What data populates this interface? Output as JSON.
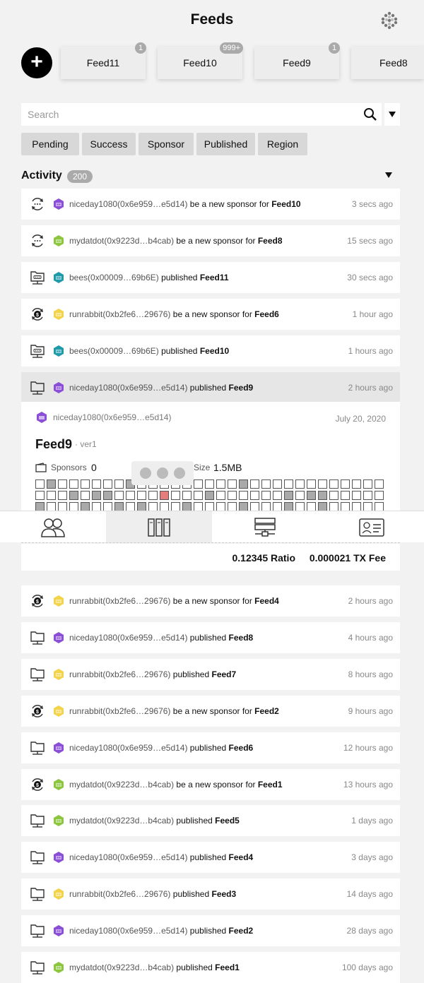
{
  "header": {
    "title": "Feeds",
    "logo_icon": "hexagon-cluster-icon"
  },
  "add_button": {
    "label": "+"
  },
  "feed_tabs": [
    {
      "label": "Feed11",
      "badge": "1"
    },
    {
      "label": "Feed10",
      "badge": "999+"
    },
    {
      "label": "Feed9",
      "badge": "1"
    },
    {
      "label": "Feed8",
      "badge": ""
    }
  ],
  "search": {
    "placeholder": "Search"
  },
  "filters": [
    "Pending",
    "Success",
    "Sponsor",
    "Published",
    "Region"
  ],
  "activity": {
    "title": "Activity",
    "count": "200"
  },
  "rows_top": [
    {
      "icon": "sponsor-loading-icon",
      "avatar": "#8a4fd6",
      "user": "niceday1080(0x6e959…e5d14)",
      "action": " be a new sponsor for ",
      "feed": "Feed10",
      "time": "3 secs ago"
    },
    {
      "icon": "sponsor-loading-icon",
      "avatar": "#8cc63f",
      "user": "mydatdot(0x9223d…b4cab)",
      "action": " be a new sponsor for ",
      "feed": "Feed8",
      "time": "15 secs ago"
    },
    {
      "icon": "published-pending-icon",
      "avatar": "#1f9aa8",
      "user": "bees(0x00009…69b6E)",
      "action": " published ",
      "feed": "Feed11",
      "time": "30 secs ago"
    },
    {
      "icon": "sponsor-dollar-icon",
      "avatar": "#f2d34a",
      "user": "runrabbit(0xb2fe6…29676)",
      "action": " be a new sponsor for ",
      "feed": "Feed6",
      "time": "1 hour ago"
    },
    {
      "icon": "published-pending-icon",
      "avatar": "#1f9aa8",
      "user": "bees(0x00009…69b6E)",
      "action": " published ",
      "feed": "Feed10",
      "time": "1 hours ago"
    },
    {
      "icon": "published-icon",
      "avatar": "#8a4fd6",
      "user": "niceday1080(0x6e959…e5d14)",
      "action": " published ",
      "feed": "Feed9",
      "time": "2 hours ago"
    }
  ],
  "detail": {
    "user": "niceday1080(0x6e959…e5d14)",
    "date": "July 20, 2020",
    "feed_name": "Feed9",
    "version": "· ver1",
    "sponsors_label": "Sponsors",
    "sponsors_value": "0",
    "size_label": "Size",
    "size_value": "1.5MB"
  },
  "nav": [
    {
      "name": "nav-users",
      "icon": "users-icon"
    },
    {
      "name": "nav-library",
      "icon": "library-icon"
    },
    {
      "name": "nav-servers",
      "icon": "server-icon"
    },
    {
      "name": "nav-profile",
      "icon": "id-card-icon"
    }
  ],
  "stats": {
    "ratio": "0.12345 Ratio",
    "fee": "0.000021 TX Fee"
  },
  "rows_bottom": [
    {
      "icon": "sponsor-dollar-icon",
      "avatar": "#f2d34a",
      "user": "runrabbit(0xb2fe6…29676)",
      "action": " be a new sponsor for ",
      "feed": "Feed4",
      "time": "2 hours ago"
    },
    {
      "icon": "published-icon",
      "avatar": "#8a4fd6",
      "user": "niceday1080(0x6e959…e5d14)",
      "action": " published ",
      "feed": "Feed8",
      "time": "4 hours ago"
    },
    {
      "icon": "published-icon",
      "avatar": "#f2d34a",
      "user": "runrabbit(0xb2fe6…29676)",
      "action": " published ",
      "feed": "Feed7",
      "time": "8 hours ago"
    },
    {
      "icon": "sponsor-dollar-icon",
      "avatar": "#f2d34a",
      "user": "runrabbit(0xb2fe6…29676)",
      "action": " be a new sponsor for ",
      "feed": "Feed2",
      "time": "9 hours ago"
    },
    {
      "icon": "published-icon",
      "avatar": "#8a4fd6",
      "user": "niceday1080(0x6e959…e5d14)",
      "action": " published ",
      "feed": "Feed6",
      "time": "12 hours ago"
    },
    {
      "icon": "sponsor-dollar-icon",
      "avatar": "#8cc63f",
      "user": "mydatdot(0x9223d…b4cab)",
      "action": " be a new sponsor for ",
      "feed": "Feed1",
      "time": "13 hours ago"
    },
    {
      "icon": "published-icon",
      "avatar": "#8cc63f",
      "user": "mydatdot(0x9223d…b4cab)",
      "action": " published ",
      "feed": "Feed5",
      "time": "1 days ago"
    },
    {
      "icon": "published-icon",
      "avatar": "#8a4fd6",
      "user": "niceday1080(0x6e959…e5d14)",
      "action": " published ",
      "feed": "Feed4",
      "time": "3 days ago"
    },
    {
      "icon": "published-icon",
      "avatar": "#f2d34a",
      "user": "runrabbit(0xb2fe6…29676)",
      "action": " published ",
      "feed": "Feed3",
      "time": "14 days ago"
    },
    {
      "icon": "published-icon",
      "avatar": "#8a4fd6",
      "user": "niceday1080(0x6e959…e5d14)",
      "action": " published ",
      "feed": "Feed2",
      "time": "28 days ago"
    },
    {
      "icon": "published-icon",
      "avatar": "#8cc63f",
      "user": "mydatdot(0x9223d…b4cab)",
      "action": " published ",
      "feed": "Feed1",
      "time": "100 days ago"
    }
  ]
}
